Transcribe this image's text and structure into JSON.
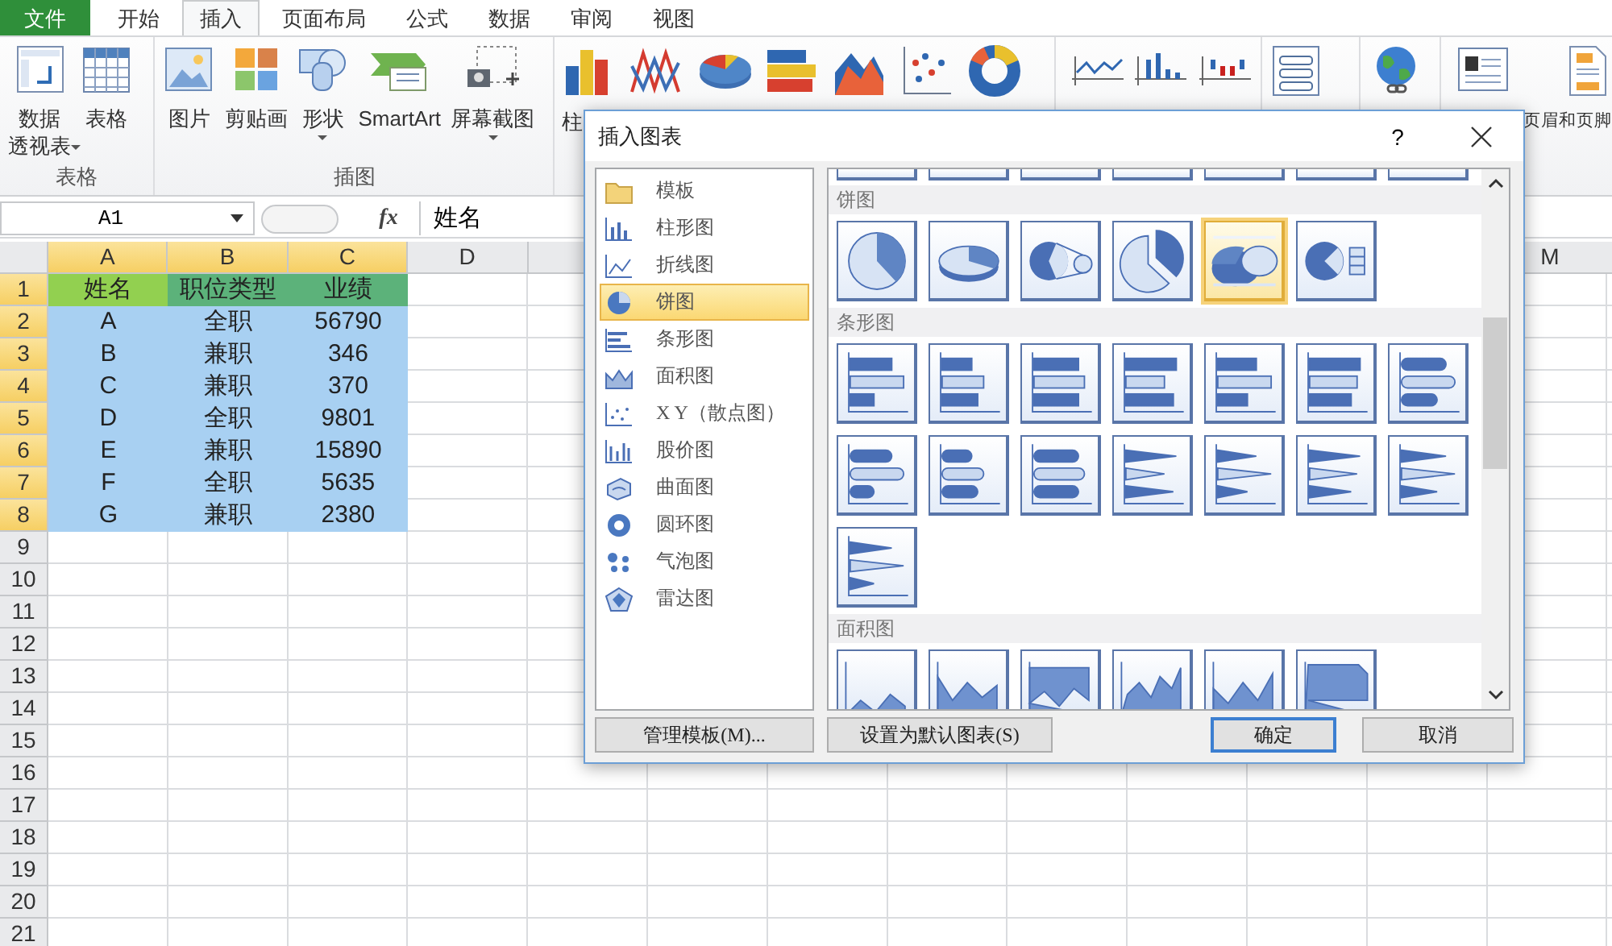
{
  "tabs": [
    {
      "label": "文件",
      "kind": "file",
      "selected": false
    },
    {
      "label": "开始",
      "kind": "tab",
      "selected": false
    },
    {
      "label": "插入",
      "kind": "tab",
      "selected": true
    },
    {
      "label": "页面布局",
      "kind": "tab",
      "selected": false
    },
    {
      "label": "公式",
      "kind": "tab",
      "selected": false
    },
    {
      "label": "数据",
      "kind": "tab",
      "selected": false
    },
    {
      "label": "审阅",
      "kind": "tab",
      "selected": false
    },
    {
      "label": "视图",
      "kind": "tab",
      "selected": false
    }
  ],
  "ribbon": {
    "groups": [
      {
        "label": "表格",
        "kind": "tables",
        "items": [
          {
            "kind": "pivot",
            "lines": [
              "数据",
              "透视表"
            ],
            "dropdown": true
          },
          {
            "kind": "table",
            "label": "表格"
          }
        ]
      },
      {
        "label": "插图",
        "kind": "illustrations",
        "items": [
          {
            "kind": "picture",
            "label": "图片"
          },
          {
            "kind": "clipart",
            "label": "剪贴画"
          },
          {
            "kind": "shapes",
            "label": "形状",
            "dropdown": true
          },
          {
            "kind": "smartart",
            "label": "SmartArt"
          },
          {
            "kind": "screenshot",
            "label": "屏幕截图",
            "dropdown": true
          }
        ]
      },
      {
        "kind": "charts",
        "items": [
          {
            "kind": "column",
            "label": "柱"
          },
          {
            "kind": "line"
          },
          {
            "kind": "pie"
          },
          {
            "kind": "bar"
          },
          {
            "kind": "area"
          },
          {
            "kind": "scatter"
          },
          {
            "kind": "donut"
          }
        ]
      },
      {
        "kind": "sparklines",
        "items": [
          {
            "kind": "spark-line"
          },
          {
            "kind": "spark-column"
          },
          {
            "kind": "spark-winloss"
          }
        ]
      },
      {
        "kind": "filter",
        "items": [
          {
            "kind": "slicer"
          }
        ]
      },
      {
        "kind": "links",
        "items": [
          {
            "kind": "hyperlink"
          }
        ]
      },
      {
        "kind": "text",
        "items": [
          {
            "kind": "textbox"
          },
          {
            "kind": "header",
            "label": "页眉和页脚"
          }
        ]
      }
    ]
  },
  "formula_bar": {
    "name_box": "A1",
    "fx": "fx",
    "formula": "姓名"
  },
  "sheet": {
    "columns": [
      {
        "label": "A",
        "selected": true
      },
      {
        "label": "B",
        "selected": true
      },
      {
        "label": "C",
        "selected": true
      },
      {
        "label": "D",
        "selected": false
      }
    ],
    "last_column": {
      "label": "M",
      "selected": false
    },
    "rows": [
      {
        "label": "1",
        "selected": true,
        "cells": [
          {
            "text": "姓名",
            "color": "#92d050"
          },
          {
            "text": "职位类型",
            "color": "#5cb27a"
          },
          {
            "text": "业绩",
            "color": "#5cb27a"
          }
        ]
      },
      {
        "label": "2",
        "selected": true,
        "cells": [
          {
            "text": "A"
          },
          {
            "text": "全职"
          },
          {
            "text": "56790"
          }
        ]
      },
      {
        "label": "3",
        "selected": true,
        "cells": [
          {
            "text": "B"
          },
          {
            "text": "兼职"
          },
          {
            "text": "346"
          }
        ]
      },
      {
        "label": "4",
        "selected": true,
        "cells": [
          {
            "text": "C"
          },
          {
            "text": "兼职"
          },
          {
            "text": "370"
          }
        ]
      },
      {
        "label": "5",
        "selected": true,
        "cells": [
          {
            "text": "D"
          },
          {
            "text": "全职"
          },
          {
            "text": "9801"
          }
        ]
      },
      {
        "label": "6",
        "selected": true,
        "cells": [
          {
            "text": "E"
          },
          {
            "text": "兼职"
          },
          {
            "text": "15890"
          }
        ]
      },
      {
        "label": "7",
        "selected": true,
        "cells": [
          {
            "text": "F"
          },
          {
            "text": "全职"
          },
          {
            "text": "5635"
          }
        ]
      },
      {
        "label": "8",
        "selected": true,
        "cells": [
          {
            "text": "G"
          },
          {
            "text": "兼职"
          },
          {
            "text": "2380"
          }
        ]
      },
      {
        "label": "9",
        "selected": false
      },
      {
        "label": "10",
        "selected": false
      },
      {
        "label": "11",
        "selected": false
      },
      {
        "label": "12",
        "selected": false
      },
      {
        "label": "13",
        "selected": false
      },
      {
        "label": "14",
        "selected": false
      },
      {
        "label": "15",
        "selected": false
      },
      {
        "label": "16",
        "selected": false
      },
      {
        "label": "17",
        "selected": false
      },
      {
        "label": "18",
        "selected": false
      },
      {
        "label": "19",
        "selected": false
      },
      {
        "label": "20",
        "selected": false
      },
      {
        "label": "21",
        "selected": false
      }
    ]
  },
  "dialog": {
    "title": "插入图表",
    "help": "?",
    "chart_types": [
      {
        "kind": "template",
        "label": "模板",
        "selected": false
      },
      {
        "kind": "column",
        "label": "柱形图",
        "selected": false
      },
      {
        "kind": "line",
        "label": "折线图",
        "selected": false
      },
      {
        "kind": "pie",
        "label": "饼图",
        "selected": true
      },
      {
        "kind": "bar",
        "label": "条形图",
        "selected": false
      },
      {
        "kind": "area",
        "label": "面积图",
        "selected": false
      },
      {
        "kind": "scatter",
        "label": "X Y（散点图）",
        "selected": false
      },
      {
        "kind": "stock",
        "label": "股价图",
        "selected": false
      },
      {
        "kind": "surface",
        "label": "曲面图",
        "selected": false
      },
      {
        "kind": "donut",
        "label": "圆环图",
        "selected": false
      },
      {
        "kind": "bubble",
        "label": "气泡图",
        "selected": false
      },
      {
        "kind": "radar",
        "label": "雷达图",
        "selected": false
      }
    ],
    "gallery": [
      {
        "kind": "line",
        "items": [
          {
            "selected": false
          },
          {
            "selected": false
          },
          {
            "selected": false
          },
          {
            "selected": false
          },
          {
            "selected": false
          },
          {
            "selected": false
          },
          {
            "selected": false
          }
        ]
      },
      {
        "kind": "pie",
        "title": "饼图",
        "items": [
          {
            "selected": false
          },
          {
            "selected": false
          },
          {
            "selected": false
          },
          {
            "selected": false
          },
          {
            "selected": true
          },
          {
            "selected": false
          }
        ]
      },
      {
        "kind": "bar",
        "title": "条形图",
        "items": [
          {
            "selected": false
          },
          {
            "selected": false
          },
          {
            "selected": false
          },
          {
            "selected": false
          },
          {
            "selected": false
          },
          {
            "selected": false
          },
          {
            "selected": false
          },
          {
            "selected": false
          },
          {
            "selected": false
          },
          {
            "selected": false
          },
          {
            "selected": false
          },
          {
            "selected": false
          },
          {
            "selected": false
          },
          {
            "selected": false
          },
          {
            "selected": false
          }
        ]
      },
      {
        "kind": "area",
        "title": "面积图",
        "items": [
          {
            "selected": false
          },
          {
            "selected": false
          },
          {
            "selected": false
          },
          {
            "selected": false
          },
          {
            "selected": false
          },
          {
            "selected": false
          }
        ]
      }
    ],
    "buttons": [
      {
        "label": "管理模板(M)...",
        "default": false
      },
      {
        "label": "设置为默认图表(S)",
        "default": false
      },
      {
        "label": "确定",
        "default": true
      },
      {
        "label": "取消",
        "default": false
      }
    ]
  }
}
